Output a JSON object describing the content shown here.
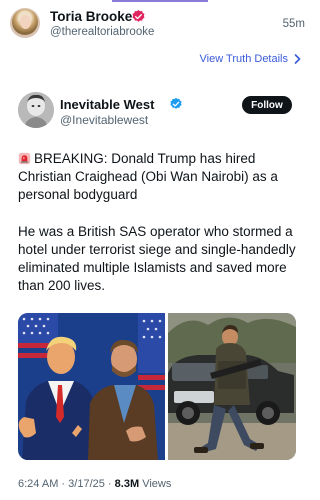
{
  "post": {
    "author_name": "Toria Brooke",
    "author_handle": "@therealtoriabrooke",
    "time_ago": "55m",
    "view_link": "View Truth Details"
  },
  "embed": {
    "author_name": "Inevitable West",
    "author_handle": "@Inevitablewest",
    "follow_label": "Follow",
    "paragraph1": "BREAKING: Donald Trump has hired Christian Craighead (Obi Wan Nairobi) as a personal bodyguard",
    "paragraph2": "He was a British SAS operator who stormed a hotel under terrorist siege and single-handedly eliminated multiple Islamists and saved more than 200 lives.",
    "time": "6:24 AM",
    "date": "3/17/25",
    "separator": "·",
    "views_count": "8.3M",
    "views_label": "Views"
  },
  "icons": {
    "verified_pink": "verified-badge-pink",
    "verified_blue": "verified-badge-blue",
    "siren": "rotating-light-emoji",
    "chevron": "chevron-right"
  },
  "colors": {
    "link": "#3b5bd9",
    "badge_pink": "#e0245e",
    "badge_blue": "#1d9bf0",
    "follow_bg": "#0f1419"
  }
}
